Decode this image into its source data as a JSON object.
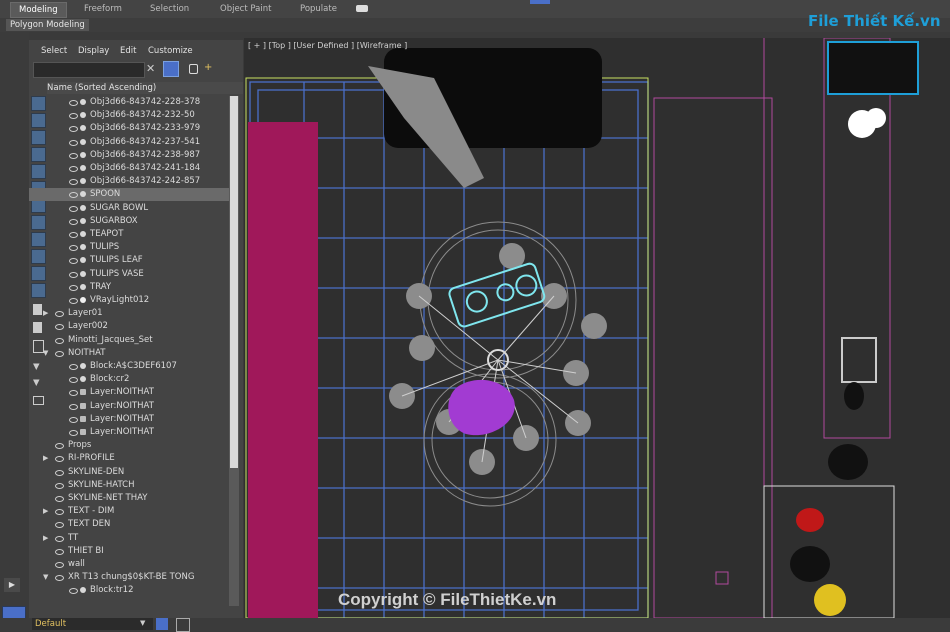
{
  "ribbon": {
    "tabs": [
      "Modeling",
      "Freeform",
      "Selection",
      "Object Paint",
      "Populate"
    ],
    "active_tab": "Modeling",
    "sub_label": "Polygon Modeling"
  },
  "explorer": {
    "menu": [
      "Select",
      "Display",
      "Edit",
      "Customize"
    ],
    "search_value": "",
    "column_header": "Name (Sorted Ascending)",
    "rows": [
      {
        "label": "Obj3d66-843742-228-378",
        "level": 2,
        "icon": "dot"
      },
      {
        "label": "Obj3d66-843742-232-50",
        "level": 2,
        "icon": "dot"
      },
      {
        "label": "Obj3d66-843742-233-979",
        "level": 2,
        "icon": "dot"
      },
      {
        "label": "Obj3d66-843742-237-541",
        "level": 2,
        "icon": "dot"
      },
      {
        "label": "Obj3d66-843742-238-987",
        "level": 2,
        "icon": "dot"
      },
      {
        "label": "Obj3d66-843742-241-184",
        "level": 2,
        "icon": "dot"
      },
      {
        "label": "Obj3d66-843742-242-857",
        "level": 2,
        "icon": "dot"
      },
      {
        "label": "SPOON",
        "level": 2,
        "icon": "dot",
        "selected": true
      },
      {
        "label": "SUGAR BOWL",
        "level": 2,
        "icon": "dot"
      },
      {
        "label": "SUGARBOX",
        "level": 2,
        "icon": "dot"
      },
      {
        "label": "TEAPOT",
        "level": 2,
        "icon": "dot"
      },
      {
        "label": "TULIPS",
        "level": 2,
        "icon": "dot"
      },
      {
        "label": "TULIPS LEAF",
        "level": 2,
        "icon": "dot"
      },
      {
        "label": "TULIPS VASE",
        "level": 2,
        "icon": "dot"
      },
      {
        "label": "TRAY",
        "level": 2,
        "icon": "dot"
      },
      {
        "label": "VRayLight012",
        "level": 2,
        "icon": "light"
      },
      {
        "label": "Layer01",
        "level": 1,
        "icon": "layer",
        "expand": "right"
      },
      {
        "label": "Layer002",
        "level": 1,
        "icon": "layer"
      },
      {
        "label": "Minotti_Jacques_Set",
        "level": 1,
        "icon": "layer"
      },
      {
        "label": "NOITHAT",
        "level": 1,
        "icon": "layer",
        "expand": "down"
      },
      {
        "label": "Block:A$C3DEF6107",
        "level": 2,
        "icon": "dot"
      },
      {
        "label": "Block:cr2",
        "level": 2,
        "icon": "dot"
      },
      {
        "label": "Layer:NOITHAT",
        "level": 2,
        "icon": "group"
      },
      {
        "label": "Layer:NOITHAT",
        "level": 2,
        "icon": "group"
      },
      {
        "label": "Layer:NOITHAT",
        "level": 2,
        "icon": "group"
      },
      {
        "label": "Layer:NOITHAT",
        "level": 2,
        "icon": "group"
      },
      {
        "label": "Props",
        "level": 1,
        "icon": "layer"
      },
      {
        "label": "RI-PROFILE",
        "level": 1,
        "icon": "layer",
        "expand": "right"
      },
      {
        "label": "SKYLINE-DEN",
        "level": 1,
        "icon": "layer"
      },
      {
        "label": "SKYLINE-HATCH",
        "level": 1,
        "icon": "layer"
      },
      {
        "label": "SKYLINE-NET THAY",
        "level": 1,
        "icon": "layer"
      },
      {
        "label": "TEXT - DIM",
        "level": 1,
        "icon": "layer",
        "expand": "right"
      },
      {
        "label": "TEXT DEN",
        "level": 1,
        "icon": "layer"
      },
      {
        "label": "TT",
        "level": 1,
        "icon": "layer",
        "expand": "right"
      },
      {
        "label": "THIET BI",
        "level": 1,
        "icon": "layer"
      },
      {
        "label": "wall",
        "level": 1,
        "icon": "layer"
      },
      {
        "label": "XR T13 chung$0$KT-BE TONG",
        "level": 1,
        "icon": "layer",
        "expand": "down"
      },
      {
        "label": "Block:tr12",
        "level": 2,
        "icon": "dot"
      }
    ]
  },
  "viewport": {
    "label": "[ + ] [Top ] [User Defined ] [Wireframe ]"
  },
  "status": {
    "layer_dropdown": "Default"
  },
  "watermark": {
    "logo": "File Thiết Kế.vn",
    "copyright": "Copyright © FileThietKe.vn"
  },
  "colors": {
    "accent_magenta": "#a0185a",
    "wire_blue": "#4a6fc8",
    "selection_cyan": "#7fe6ee",
    "purple": "#a23bd2",
    "logo_blue": "#1e9fd8"
  }
}
